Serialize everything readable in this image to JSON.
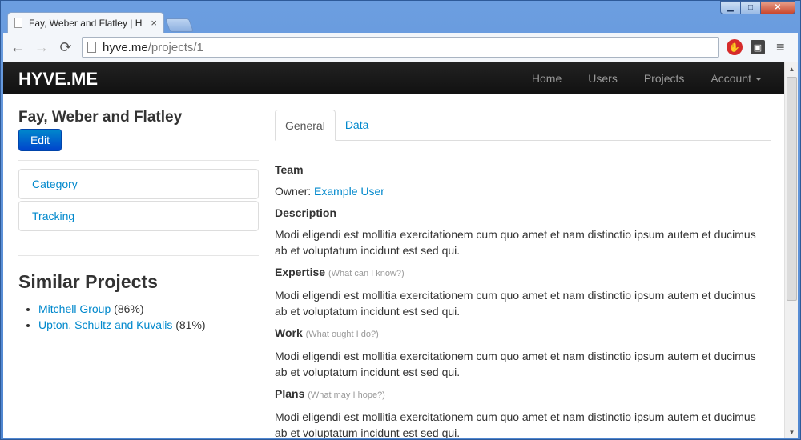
{
  "browser": {
    "tab_title": "Fay, Weber and Flatley | H",
    "tab_close": "×",
    "url_host": "hyve.me",
    "url_path": "/projects/1",
    "back_icon": "←",
    "forward_icon": "→",
    "reload_icon": "⟳",
    "ext_red_icon": "✋",
    "ext_dark_icon": "▣",
    "menu_icon": "≡",
    "win_min": "▁",
    "win_max": "□",
    "win_close": "✕"
  },
  "navbar": {
    "brand": "HYVE.ME",
    "links": [
      "Home",
      "Users",
      "Projects",
      "Account"
    ]
  },
  "sidebar": {
    "project_title": "Fay, Weber and Flatley",
    "edit_label": "Edit",
    "items": [
      "Category",
      "Tracking"
    ],
    "similar_title": "Similar Projects",
    "similar": [
      {
        "name": "Mitchell Group",
        "score": "(86%)"
      },
      {
        "name": "Upton, Schultz and Kuvalis",
        "score": "(81%)"
      }
    ]
  },
  "main": {
    "tabs": [
      "General",
      "Data"
    ],
    "team_heading": "Team",
    "owner_label": "Owner:",
    "owner_name": "Example User",
    "description_heading": "Description",
    "description_text": "Modi eligendi est mollitia exercitationem cum quo amet et nam distinctio ipsum autem et ducimus ab et voluptatum incidunt est sed qui.",
    "expertise_heading": "Expertise",
    "expertise_hint": "(What can I know?)",
    "expertise_text": "Modi eligendi est mollitia exercitationem cum quo amet et nam distinctio ipsum autem et ducimus ab et voluptatum incidunt est sed qui.",
    "work_heading": "Work",
    "work_hint": "(What ought I do?)",
    "work_text": "Modi eligendi est mollitia exercitationem cum quo amet et nam distinctio ipsum autem et ducimus ab et voluptatum incidunt est sed qui.",
    "plans_heading": "Plans",
    "plans_hint": "(What may I hope?)",
    "plans_text": "Modi eligendi est mollitia exercitationem cum quo amet et nam distinctio ipsum autem et ducimus ab et voluptatum incidunt est sed qui."
  },
  "colors": {
    "link": "#0088cc",
    "navbar": "#1b1b1b",
    "button": "#0066cc"
  }
}
